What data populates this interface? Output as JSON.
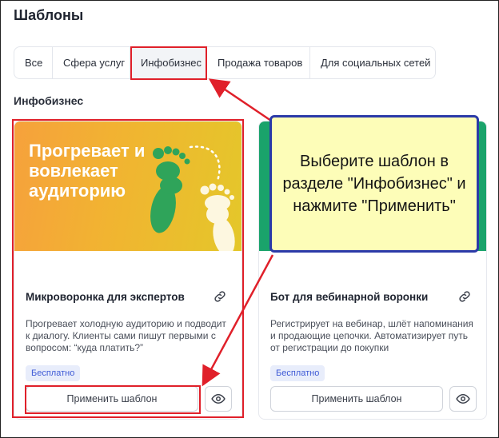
{
  "page": {
    "title": "Шаблоны"
  },
  "tabs": [
    {
      "label": "Все"
    },
    {
      "label": "Сфера услуг"
    },
    {
      "label": "Инфобизнес",
      "active": true
    },
    {
      "label": "Продажа товаров"
    },
    {
      "label": "Для социальных сетей"
    }
  ],
  "section": {
    "title": "Инфобизнес"
  },
  "cards": [
    {
      "promo_text": "Прогревает и вовлекает аудиторию",
      "title": "Микроворонка для экспертов",
      "description": "Прогревает холодную аудиторию и подводит к диалогу. Клиенты сами пишут первыми с вопросом: “куда платить?”",
      "badge": "Бесплатно",
      "apply_label": "Применить шаблон"
    },
    {
      "promo_text": "",
      "title": "Бот для вебинарной воронки",
      "description": "Регистрирует на вебинар, шлёт напоминания и продающие цепочки. Автоматизирует путь от регистрации до покупки",
      "badge": "Бесплатно",
      "apply_label": "Применить шаблон"
    }
  ],
  "callout": {
    "text": "Выберите шаблон в разделе \"Инфобизнес\" и нажмите \"Применить\""
  },
  "colors": {
    "highlight": "#e0202a",
    "callout_bg": "#fdfdb8",
    "callout_border": "#2b3aa8",
    "badge_text": "#3f5bd6"
  },
  "icons": [
    "link-icon",
    "eye-icon",
    "footprints-illustration"
  ]
}
